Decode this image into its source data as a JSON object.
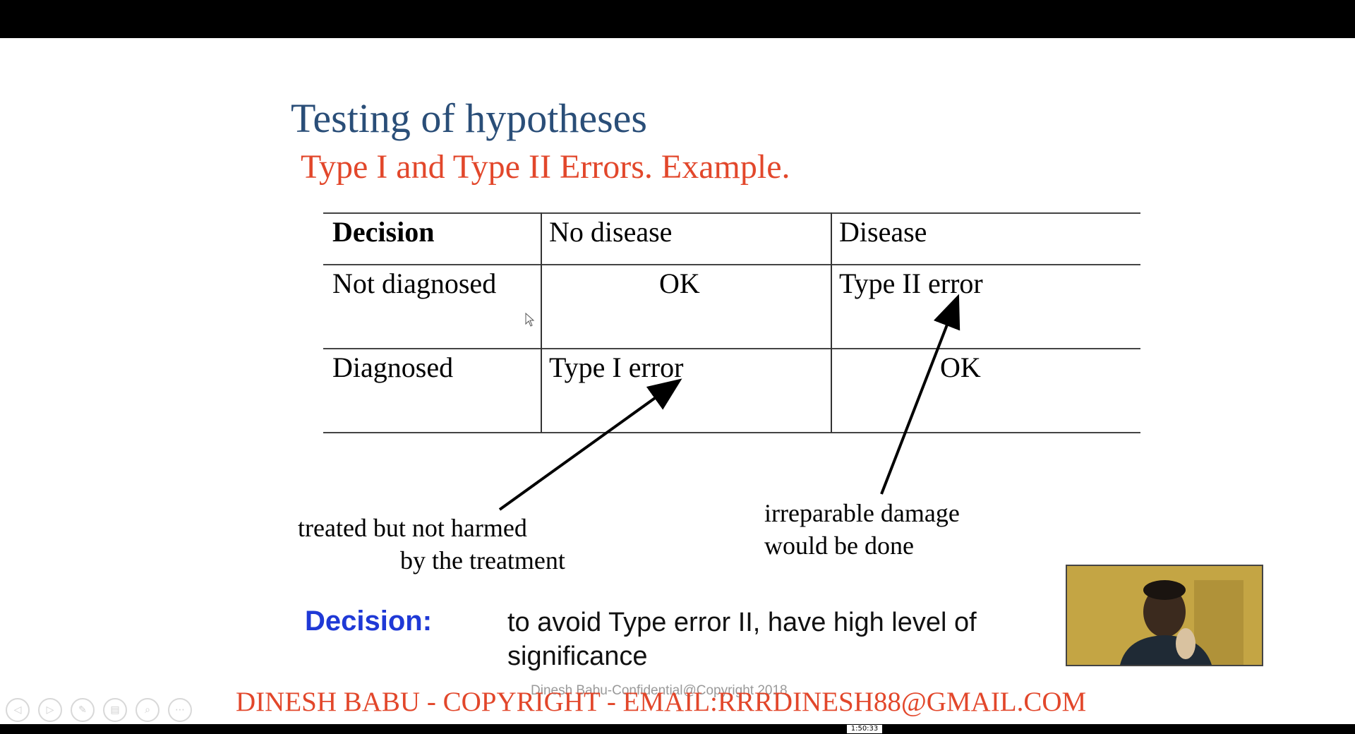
{
  "slide": {
    "title": "Testing of hypotheses",
    "subtitle": "Type I and Type II Errors. Example.",
    "table": {
      "headers": [
        "Decision",
        "No disease",
        "Disease"
      ],
      "rows": [
        [
          "Not diagnosed",
          "OK",
          "Type II error"
        ],
        [
          "Diagnosed",
          "Type I error",
          "OK"
        ]
      ]
    },
    "notes": {
      "type1_line1": "treated but not harmed",
      "type1_line2": "by the treatment",
      "type2_line1": "irreparable damage",
      "type2_line2": "would be done"
    },
    "decision_label": "Decision:",
    "decision_line1": "to avoid Type error II, have high level of",
    "decision_line2": "significance",
    "watermark": "Dinesh Babu-Confidential@Copyright 2018",
    "copyright": "DINESH BABU - COPYRIGHT - EMAIL:RRRDINESH88@GMAIL.COM"
  },
  "player": {
    "timecode": "1:50:33",
    "controls": [
      "prev-icon",
      "play-icon",
      "pen-icon",
      "pages-icon",
      "zoom-icon",
      "more-icon"
    ]
  },
  "colors": {
    "title": "#2a4e78",
    "accent_red": "#e2472b",
    "decision_blue": "#1f39d6"
  }
}
